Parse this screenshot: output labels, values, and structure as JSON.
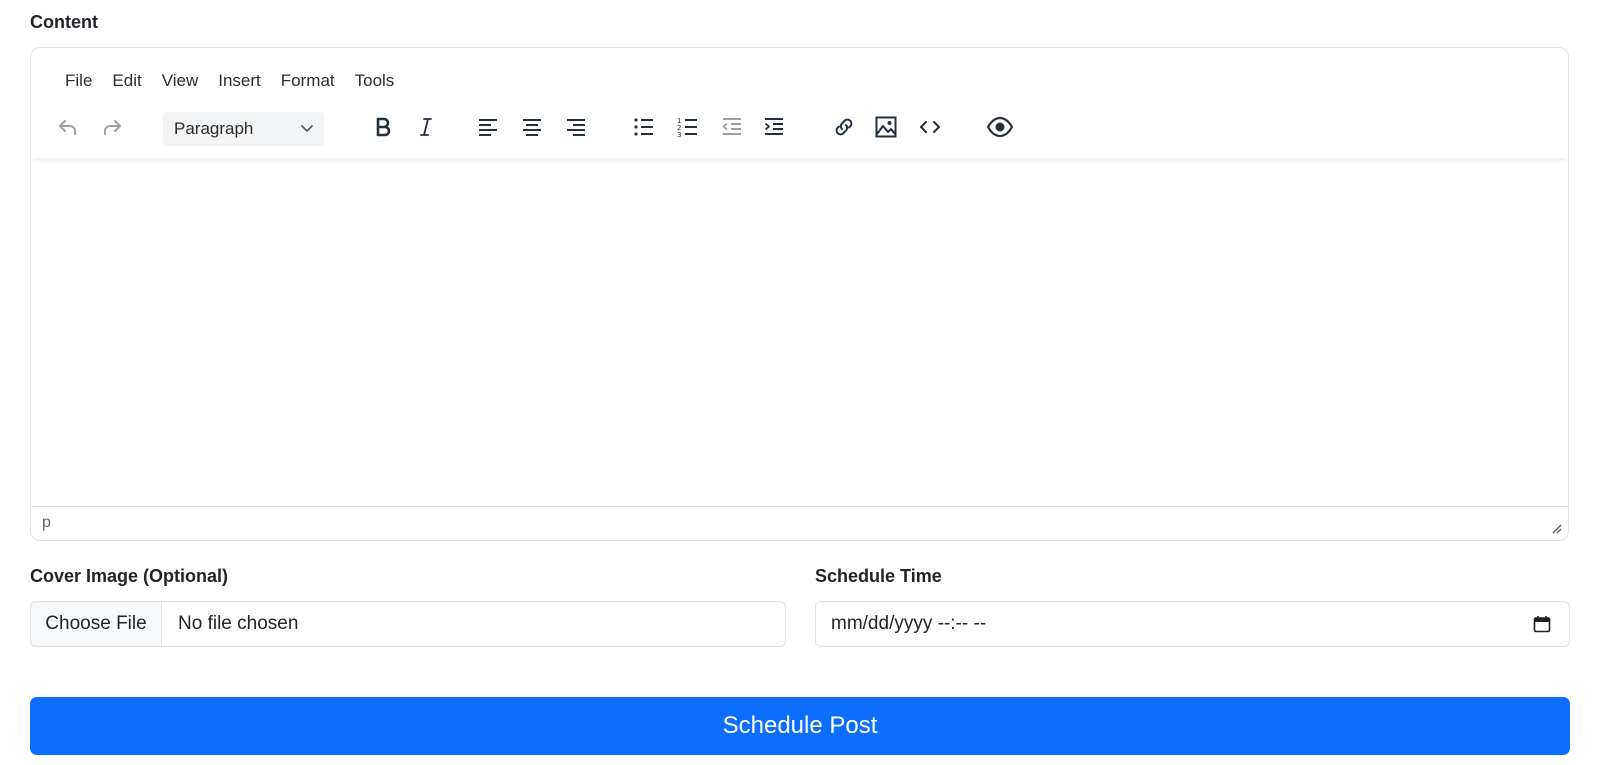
{
  "content_label": "Content",
  "editor": {
    "menubar": [
      "File",
      "Edit",
      "View",
      "Insert",
      "Format",
      "Tools"
    ],
    "block_format": "Paragraph",
    "status_path": "p"
  },
  "cover_image": {
    "label": "Cover Image (Optional)",
    "button": "Choose File",
    "file_name": "No file chosen"
  },
  "schedule_time": {
    "label": "Schedule Time",
    "placeholder": "mm/dd/yyyy --:-- --"
  },
  "submit_label": "Schedule Post",
  "colors": {
    "primary": "#0d6efd",
    "border": "#dee2e6",
    "icon": "#222f3e",
    "icon_disabled": "#9aa0a6"
  }
}
